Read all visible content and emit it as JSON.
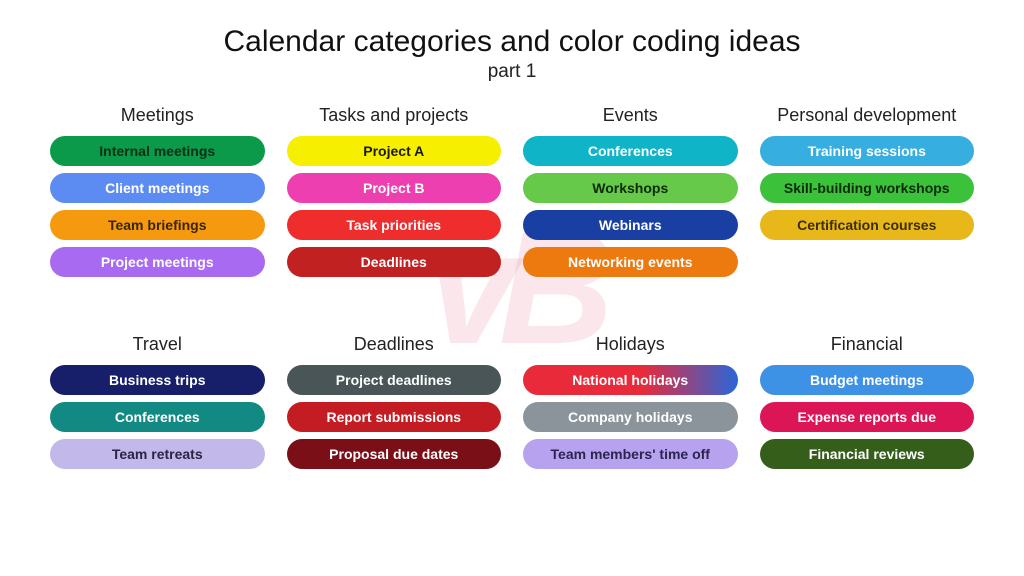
{
  "title": "Calendar categories and color coding ideas",
  "subtitle": "part 1",
  "watermark": "vB",
  "columns": [
    {
      "header": "Meetings",
      "items": [
        {
          "label": "Internal meetings",
          "bg": "#0a9a4a",
          "fg": "#0b2e17"
        },
        {
          "label": "Client meetings",
          "bg": "#5c8cf2",
          "fg": "#ffffff"
        },
        {
          "label": "Team briefings",
          "bg": "#f59a0e",
          "fg": "#3a2403"
        },
        {
          "label": "Project meetings",
          "bg": "#a96af2",
          "fg": "#ffffff"
        }
      ]
    },
    {
      "header": "Tasks and projects",
      "items": [
        {
          "label": "Project A",
          "bg": "#f7ef00",
          "fg": "#1a1a00"
        },
        {
          "label": "Project B",
          "bg": "#ed3fb0",
          "fg": "#ffffff"
        },
        {
          "label": "Task priorities",
          "bg": "#ef2d2d",
          "fg": "#ffffff"
        },
        {
          "label": "Deadlines",
          "bg": "#c22121",
          "fg": "#ffffff"
        }
      ]
    },
    {
      "header": "Events",
      "items": [
        {
          "label": "Conferences",
          "bg": "#0fb4c6",
          "fg": "#ffffff"
        },
        {
          "label": "Workshops",
          "bg": "#66c94a",
          "fg": "#0e2a08"
        },
        {
          "label": "Webinars",
          "bg": "#1a3fa3",
          "fg": "#ffffff"
        },
        {
          "label": "Networking events",
          "bg": "#ed7a0f",
          "fg": "#ffffff"
        }
      ]
    },
    {
      "header": "Personal development",
      "items": [
        {
          "label": "Training sessions",
          "bg": "#36aee0",
          "fg": "#ffffff"
        },
        {
          "label": "Skill-building workshops",
          "bg": "#3cc23a",
          "fg": "#0a2a09"
        },
        {
          "label": "Certification courses",
          "bg": "#e8b81a",
          "fg": "#3a2c03"
        }
      ]
    },
    {
      "header": "Travel",
      "items": [
        {
          "label": "Business trips",
          "bg": "#171f6b",
          "fg": "#ffffff"
        },
        {
          "label": "Conferences",
          "bg": "#128a83",
          "fg": "#ffffff"
        },
        {
          "label": "Team retreats",
          "bg": "#c3b8ea",
          "fg": "#2a2544"
        }
      ]
    },
    {
      "header": "Deadlines",
      "items": [
        {
          "label": "Project deadlines",
          "bg": "#4a5558",
          "fg": "#ffffff"
        },
        {
          "label": "Report submissions",
          "bg": "#c31c22",
          "fg": "#ffffff"
        },
        {
          "label": "Proposal due dates",
          "bg": "#7a0f17",
          "fg": "#ffffff"
        }
      ]
    },
    {
      "header": "Holidays",
      "items": [
        {
          "label": "National holidays",
          "bg": "linear-gradient(90deg,#e92a3a 0%,#e92a3a 55%,#2a66d8 100%)",
          "fg": "#ffffff"
        },
        {
          "label": "Company holidays",
          "bg": "#8a949a",
          "fg": "#ffffff"
        },
        {
          "label": "Team members' time off",
          "bg": "#b6a2ee",
          "fg": "#2d2450"
        }
      ]
    },
    {
      "header": "Financial",
      "items": [
        {
          "label": "Budget meetings",
          "bg": "#3e92e6",
          "fg": "#ffffff"
        },
        {
          "label": "Expense reports due",
          "bg": "#dc1556",
          "fg": "#ffffff"
        },
        {
          "label": "Financial reviews",
          "bg": "#355e1a",
          "fg": "#ffffff"
        }
      ]
    }
  ]
}
